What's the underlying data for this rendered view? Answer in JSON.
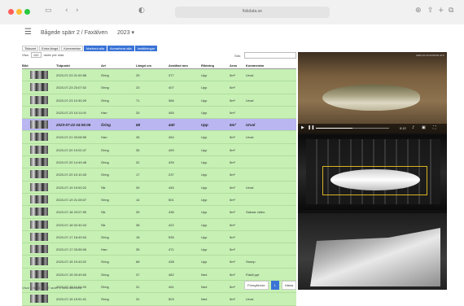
{
  "browser": {
    "url": "fiskdata.se",
    "back_icon": "chevron-left-icon",
    "forward_icon": "chevron-right-icon"
  },
  "app": {
    "title": "Bågede spärr 2 / Faxälven",
    "year": "2023 ▾",
    "menu_icon": "hamburger-icon"
  },
  "tabs": [
    {
      "label": "Tidsvart",
      "active": false
    },
    {
      "label": "Extra längd",
      "active": false
    },
    {
      "label": "Kommentar",
      "active": false
    },
    {
      "label": "Markera alla",
      "active": true
    },
    {
      "label": "Avmarkera alla",
      "active": true
    },
    {
      "label": "Inställningar",
      "active": true
    }
  ],
  "controls": {
    "visa_label": "Visa",
    "page_size": "100",
    "rows_label": "rader per sida",
    "search_label": "Sök:"
  },
  "table": {
    "headers": [
      "Bild",
      "Tidpunkt",
      "Art",
      "Längd cm",
      "Avstånd mm",
      "Riktning",
      "Area",
      "Kommentar"
    ],
    "rows": [
      {
        "time": "2023-07-23 21:00:58",
        "art": "Öring",
        "langd": "25",
        "avstand": "377",
        "riktning": "Upp",
        "area": "5m²",
        "kommentar": "Urval"
      },
      {
        "time": "2023-07-23 23:07:02",
        "art": "Öring",
        "langd": "23",
        "avstand": "407",
        "riktning": "Upp",
        "area": "5m²",
        "kommentar": ""
      },
      {
        "time": "2023-07-23 10:30:29",
        "art": "Öring",
        "langd": "71",
        "avstand": "366",
        "riktning": "Upp",
        "area": "5m²",
        "kommentar": "Urval"
      },
      {
        "time": "2023-07-23 10:11:00",
        "art": "Harr",
        "langd": "33",
        "avstand": "455",
        "riktning": "Upp",
        "area": "5m²",
        "kommentar": ""
      },
      {
        "time": "2023-07-22 04:05:06",
        "art": "Öring",
        "langd": "68",
        "avstand": "440",
        "riktning": "Upp",
        "area": "5m²",
        "kommentar": "Urval",
        "selected": true
      },
      {
        "time": "2023-07-21 03:08:55",
        "art": "Harr",
        "langd": "45",
        "avstand": "454",
        "riktning": "Upp",
        "area": "5m²",
        "kommentar": "Urval"
      },
      {
        "time": "2023-07-20 19:02:47",
        "art": "Öring",
        "langd": "35",
        "avstand": "499",
        "riktning": "Upp",
        "area": "5m²",
        "kommentar": ""
      },
      {
        "time": "2023-07-20 14:49:48",
        "art": "Öring",
        "langd": "32",
        "avstand": "439",
        "riktning": "Upp",
        "area": "5m²",
        "kommentar": ""
      },
      {
        "time": "2023-07-20 10:10:43",
        "art": "Öring",
        "langd": "17",
        "avstand": "237",
        "riktning": "Upp",
        "area": "5m²",
        "kommentar": ""
      },
      {
        "time": "2023-07-19 19:53:22",
        "art": "Sik",
        "langd": "39",
        "avstand": "445",
        "riktning": "Upp",
        "area": "5m²",
        "kommentar": "Urval"
      },
      {
        "time": "2023-07-19 21:05:07",
        "art": "Öring",
        "langd": "14",
        "avstand": "501",
        "riktning": "Upp",
        "area": "5m²",
        "kommentar": ""
      },
      {
        "time": "2023-07-18 23:07:59",
        "art": "Sik",
        "langd": "39",
        "avstand": "436",
        "riktning": "Upp",
        "area": "5m²",
        "kommentar": "Saknar video"
      },
      {
        "time": "2023-07-18 02:40:24",
        "art": "Sik",
        "langd": "38",
        "avstand": "422",
        "riktning": "Upp",
        "area": "5m²",
        "kommentar": ""
      },
      {
        "time": "2023-07-17 18:49:04",
        "art": "Öring",
        "langd": "18",
        "avstand": "535",
        "riktning": "Upp",
        "area": "5m²",
        "kommentar": ""
      },
      {
        "time": "2023-07-17 03:55:05",
        "art": "Harr",
        "langd": "35",
        "avstand": "471",
        "riktning": "Upp",
        "area": "5m²",
        "kommentar": ""
      },
      {
        "time": "2023-07-15 19:43:22",
        "art": "Öring",
        "langd": "68",
        "avstand": "438",
        "riktning": "Upp",
        "area": "5m²",
        "kommentar": "Stump"
      },
      {
        "time": "2023-07-15 03:49:00",
        "art": "Öring",
        "langd": "37",
        "avstand": "482",
        "riktning": "Ned",
        "area": "5m²",
        "kommentar": "Fisk8 ppt"
      },
      {
        "time": "2023-07-15 11:01:26",
        "art": "Öring",
        "langd": "31",
        "avstand": "451",
        "riktning": "Ned",
        "area": "5m²",
        "kommentar": ""
      },
      {
        "time": "2023-07-15 19:51:01",
        "art": "Öring",
        "langd": "31",
        "avstand": "503",
        "riktning": "Ned",
        "area": "5m²",
        "kommentar": "Urval"
      }
    ]
  },
  "footer": {
    "info": "Visar 1 till 81 av 87 rader 1 rows selected",
    "prev": "Föregående",
    "page": "1",
    "next": "Nästa"
  },
  "video": {
    "top_timestamp": "2023-07-22 04:05:06 UTC",
    "current_time": "0:12",
    "progress": 0.5
  }
}
